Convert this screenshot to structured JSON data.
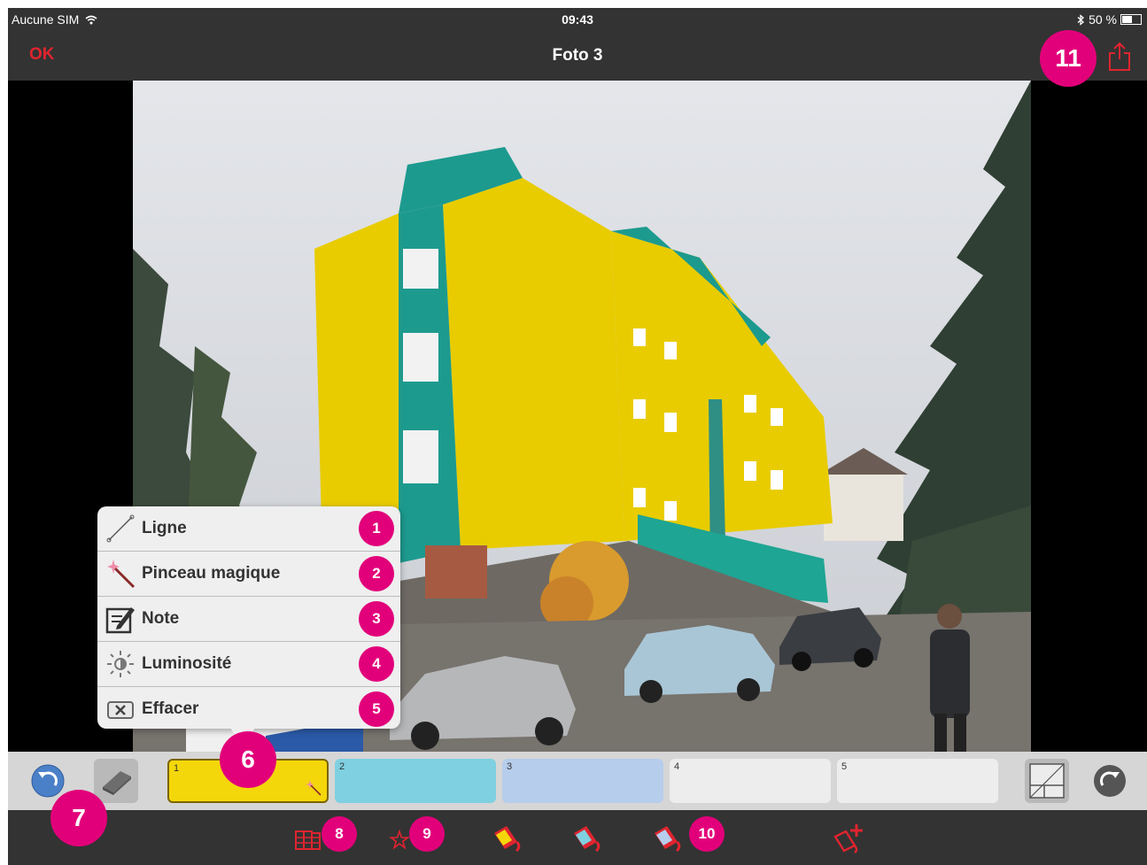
{
  "status_bar": {
    "carrier": "Aucune SIM",
    "time": "09:43",
    "battery": "50 %",
    "battery_level": 0.5
  },
  "nav": {
    "done_label": "OK",
    "title": "Foto 3"
  },
  "menu": {
    "items": [
      {
        "label": "Ligne",
        "badge": "1",
        "icon": "line-icon"
      },
      {
        "label": "Pinceau magique",
        "badge": "2",
        "icon": "magic-brush-icon"
      },
      {
        "label": "Note",
        "badge": "3",
        "icon": "note-icon"
      },
      {
        "label": "Luminosité",
        "badge": "4",
        "icon": "brightness-icon"
      },
      {
        "label": "Effacer",
        "badge": "5",
        "icon": "delete-icon"
      }
    ]
  },
  "swatches": [
    {
      "num": "1",
      "color": "#f4d70a",
      "selected": true
    },
    {
      "num": "2",
      "color": "#7fd0e0",
      "selected": false
    },
    {
      "num": "3",
      "color": "#b6cdec",
      "selected": false
    },
    {
      "num": "4",
      "color": "#ededed",
      "selected": false
    },
    {
      "num": "5",
      "color": "#ededed",
      "selected": false
    }
  ],
  "annotations": {
    "b6": "6",
    "b7": "7",
    "b8": "8",
    "b9": "9",
    "b10": "10",
    "b11": "11"
  },
  "colors": {
    "accent": "#e0242f",
    "badge": "#e2007a",
    "bar": "#333333",
    "building_yellow": "#e8cc00",
    "building_teal": "#1d9a8e"
  },
  "icons": {
    "undo": "undo-icon",
    "eraser": "eraser-icon",
    "grid": "grid-icon",
    "redo": "redo-icon",
    "palette": "color-book-icon",
    "favorites": "star-icon",
    "bucket1": "paint-bucket-icon",
    "bucket2": "paint-bucket-icon",
    "bucket3": "paint-bucket-icon",
    "add": "add-color-icon",
    "share": "share-icon"
  }
}
